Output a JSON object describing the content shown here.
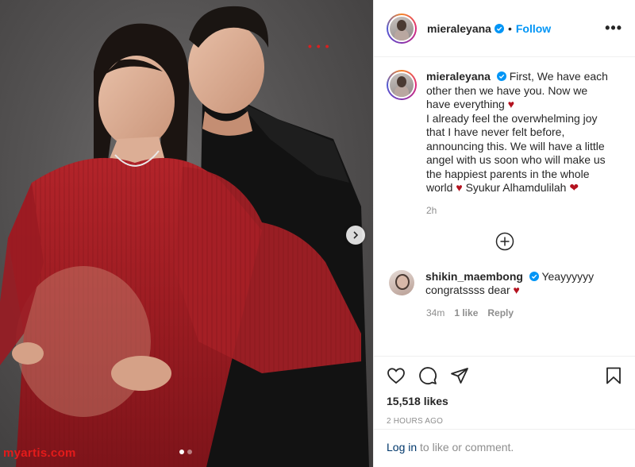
{
  "post": {
    "author": "mieraleyana",
    "separator": "•",
    "follow_label": "Follow",
    "more_label": "•••",
    "caption_lines": [
      "First, We have each other then we have you. Now we have everything",
      "I already feel the overwhelming joy that I have never felt before, announcing this. We will have a little angel with us soon who will make us the happiest parents in the whole world",
      "Syukur Alhamdulilah"
    ],
    "caption_time": "2h",
    "likes": "15,518 likes",
    "posted": "2 HOURS AGO"
  },
  "comment": {
    "author": "shikin_maembong",
    "text_1": "Yeayyyyyy congratssss dear",
    "time": "34m",
    "likes": "1 like",
    "reply": "Reply"
  },
  "login": {
    "link": "Log in",
    "rest": " to like or comment."
  },
  "photo": {
    "watermark": "myartis.com",
    "slide_count": 2,
    "active_slide": 1
  },
  "icons": {
    "verified": "verified-badge-icon",
    "more": "more-options-icon",
    "load_more": "plus-circle-icon",
    "like": "heart-icon",
    "comment": "comment-bubble-icon",
    "share": "paper-plane-icon",
    "save": "bookmark-icon",
    "next": "chevron-right-icon"
  },
  "colors": {
    "accent": "#0095f6",
    "heart": "#b4121f",
    "watermark": "#e31b1b",
    "link": "#00376b",
    "muted": "#8e8e8e"
  }
}
